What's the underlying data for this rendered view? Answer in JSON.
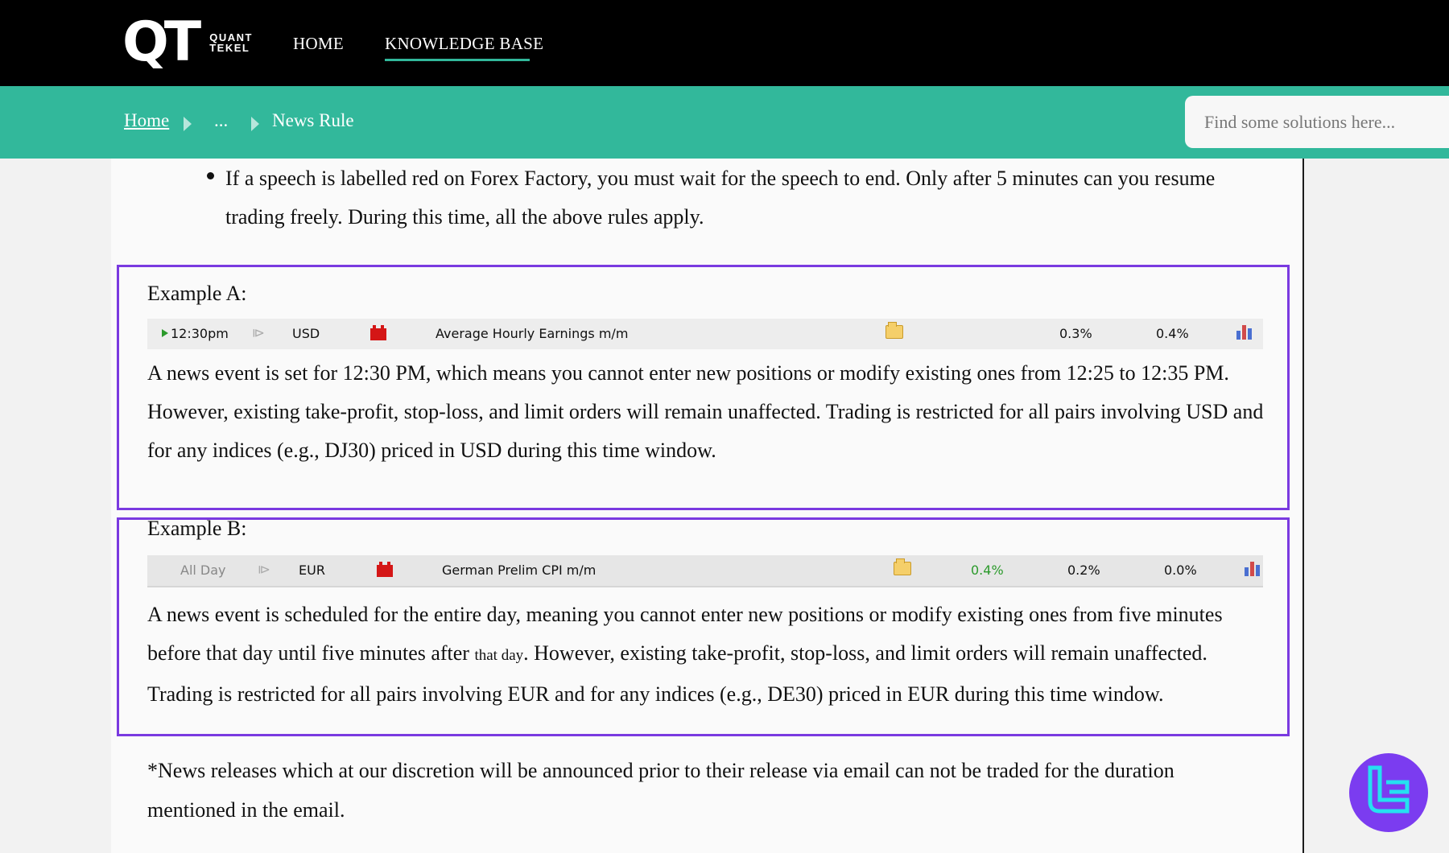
{
  "topnav": {
    "logo_mark": "QT",
    "logo_sub_1": "QUANT",
    "logo_sub_2": "TEKEL",
    "links": [
      "HOME",
      "KNOWLEDGE BASE"
    ],
    "active_link": "KNOWLEDGE BASE"
  },
  "breadcrumb": {
    "home": "Home",
    "ellipsis": "...",
    "current": "News Rule"
  },
  "search": {
    "placeholder": "Find some solutions here..."
  },
  "content": {
    "bullet": "If a speech is labelled red on Forex Factory, you must wait for the speech to end. Only after 5 minutes can you resume trading freely. During this time, all the above rules apply.",
    "example_a": {
      "title": "Example A:",
      "row": {
        "time": "12:30pm",
        "currency": "USD",
        "event": "Average Hourly Earnings m/m",
        "forecast": "0.3%",
        "previous": "0.4%"
      },
      "text": "A news event is set for 12:30 PM, which means you cannot enter new positions or modify existing ones from 12:25 to 12:35 PM. However, existing take-profit, stop-loss, and limit orders will remain unaffected. Trading is restricted for all pairs involving USD and for any indices (e.g., DJ30) priced in USD during this time window."
    },
    "example_b": {
      "title": "Example B:",
      "row": {
        "time": "All Day",
        "currency": "EUR",
        "event": "German Prelim CPI m/m",
        "actual": "0.4%",
        "forecast": "0.2%",
        "previous": "0.0%"
      },
      "text_1": "A news event is scheduled for the entire day, meaning you cannot enter new positions or modify existing ones from five minutes before that day until five minutes after ",
      "text_small": "that day",
      "text_2": ". However, existing take-profit, stop-loss, and limit orders will remain unaffected. Trading is restricted for all pairs involving EUR and for any indices (e.g., DE30) priced in EUR during this time window."
    },
    "note": "*News releases which at our discretion will be announced prior to their release via email can not be traded for the duration mentioned in the email."
  },
  "colors": {
    "teal": "#32b89b",
    "purple_border": "#7a3ae0",
    "impact_red": "#d41616",
    "actual_green": "#2b9a2b"
  },
  "icons": [
    "play-icon",
    "speaker-icon",
    "high-impact-icon",
    "detail-folder-icon",
    "bar-chart-icon",
    "chat-badge-logo-icon"
  ]
}
